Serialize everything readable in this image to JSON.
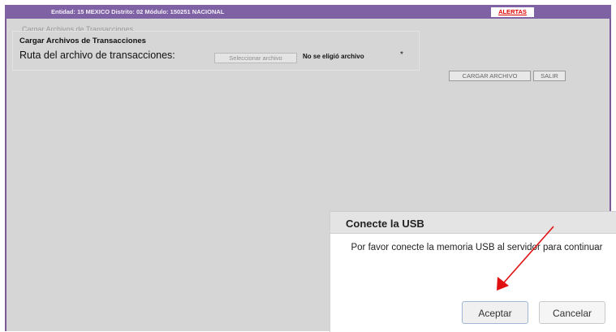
{
  "header": {
    "info": "Entidad: 15 MEXICO Distrito: 02 Módulo: 150251 NACIONAL",
    "alert_label": "ALERTAS"
  },
  "background_text": "Cargar Archivos de Transacciones",
  "upload_panel": {
    "title": "Cargar Archivos de Transacciones",
    "path_label": "Ruta del archivo de transacciones:",
    "file_button_label": "Seleccionar archivo",
    "file_status": "No se eligió archivo",
    "required_mark": "*"
  },
  "actions": {
    "load_label": "CARGAR ARCHIVO",
    "exit_label": "SALIR"
  },
  "dialog": {
    "title": "Conecte la USB",
    "message": "Por favor conecte la memoria USB al servidor para continuar",
    "accept_label": "Aceptar",
    "cancel_label": "Cancelar"
  },
  "annotation": {
    "arrow_color": "#e01010"
  }
}
